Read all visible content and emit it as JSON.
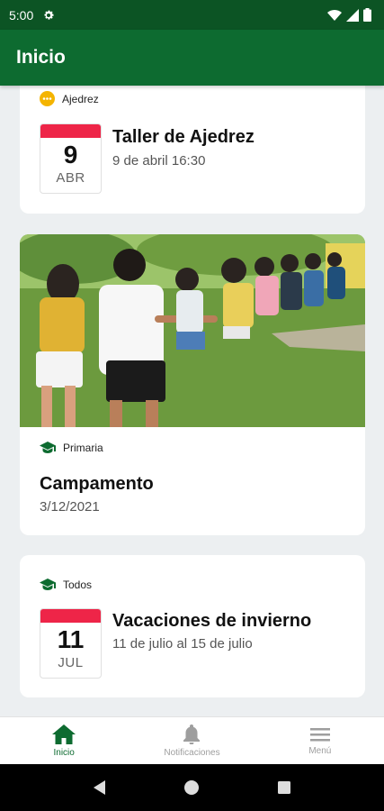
{
  "status_bar": {
    "time": "5:00",
    "icons": [
      "gear-icon",
      "wifi-icon",
      "signal-icon",
      "battery-icon"
    ]
  },
  "app_bar": {
    "title": "Inicio"
  },
  "feed": [
    {
      "kind": "event",
      "tag": {
        "icon": "dots-circle-icon",
        "label": "Ajedrez"
      },
      "date": {
        "day": "9",
        "month": "ABR"
      },
      "title": "Taller de Ajedrez",
      "subtitle": "9 de abril 16:30"
    },
    {
      "kind": "news",
      "image": "kids-outdoor-group-photo",
      "tag": {
        "icon": "graduation-cap-icon",
        "label": "Primaria"
      },
      "title": "Campamento",
      "subtitle": "3/12/2021"
    },
    {
      "kind": "event",
      "tag": {
        "icon": "graduation-cap-icon",
        "label": "Todos"
      },
      "date": {
        "day": "11",
        "month": "JUL"
      },
      "title": "Vacaciones de invierno",
      "subtitle": "11 de julio al 15 de julio"
    }
  ],
  "bottom_nav": [
    {
      "icon": "home-icon",
      "label": "Inicio",
      "active": true
    },
    {
      "icon": "bell-icon",
      "label": "Notificaciones",
      "active": false
    },
    {
      "icon": "menu-icon",
      "label": "Menú",
      "active": false
    }
  ],
  "colors": {
    "status_bar": "#0c5424",
    "app_bar": "#0d6b30",
    "accent_green": "#0d6b30",
    "calendar_red": "#ee2548",
    "chess_tag_yellow": "#f4b400",
    "background": "#eceff1"
  }
}
